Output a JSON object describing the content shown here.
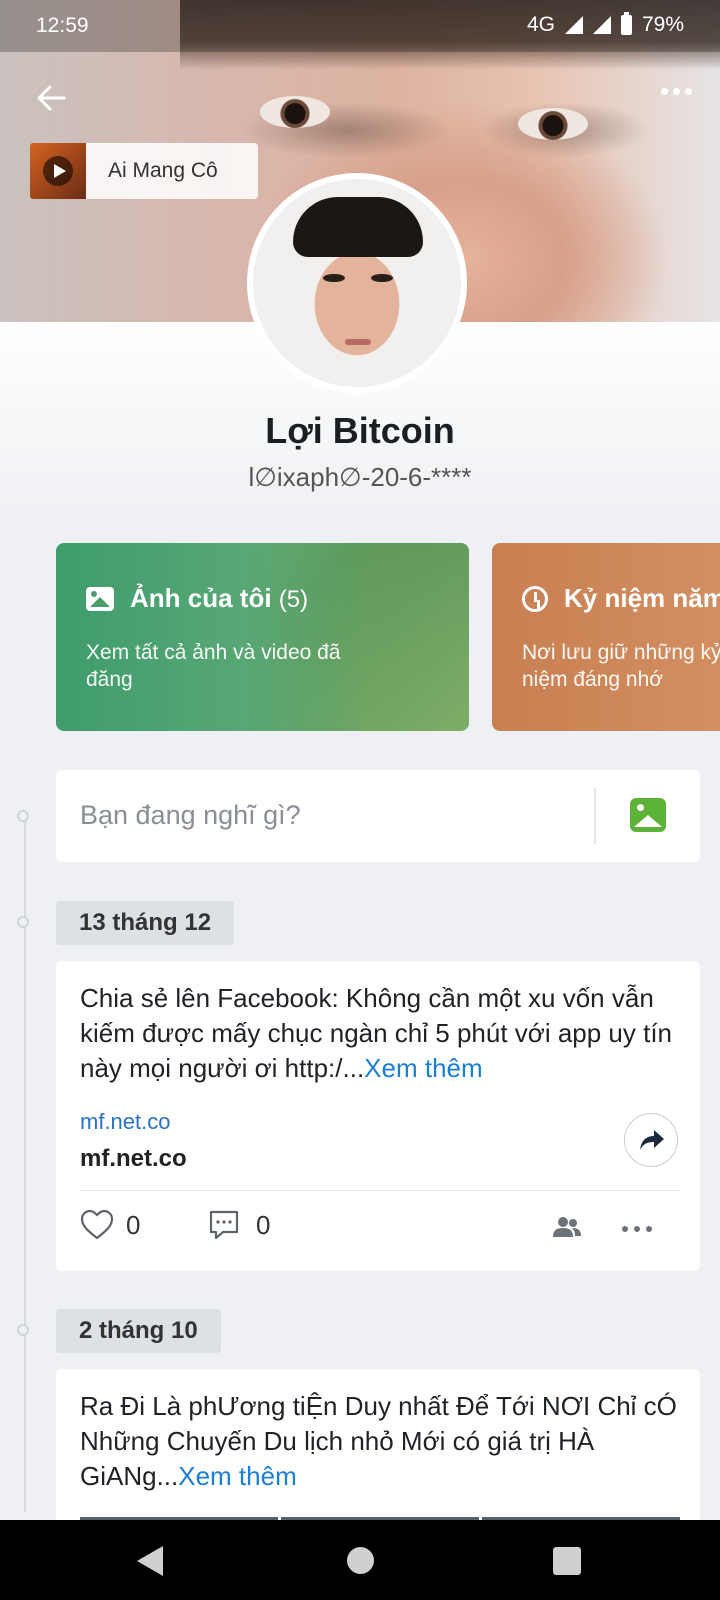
{
  "status_bar": {
    "time": "12:59",
    "network": "4G",
    "battery": "79%"
  },
  "music": {
    "title": "Ai Mang Cô"
  },
  "profile": {
    "name": "Lợi Bitcoin",
    "username": "l∅ixaph∅-20-6-****"
  },
  "cards": [
    {
      "title": "Ảnh của tôi",
      "count": "(5)",
      "desc": "Xem tất cả ảnh và video đã đăng",
      "icon": "image-icon"
    },
    {
      "title": "Kỷ niệm năm",
      "desc": "Nơi lưu giữ những kỷ niệm đáng nhớ",
      "icon": "clock-icon"
    }
  ],
  "composer": {
    "placeholder": "Bạn đang nghĩ gì?"
  },
  "posts": [
    {
      "date": "13 tháng 12",
      "text": "Chia sẻ lên Facebook: Không cần một xu vốn vẫn kiếm được mấy chục ngàn chỉ 5 phút với app uy tín này mọi người ơi http:/...",
      "more": "Xem thêm",
      "link_url": "mf.net.co",
      "link_title": "mf.net.co",
      "likes": "0",
      "comments": "0"
    },
    {
      "date": "2 tháng 10",
      "text": "Ra Đi Là phƯơng tiỆn Duy nhất Để Tới NƠI Chỉ cÓ Những Chuyến Du lịch nhỏ Mới có giá trị HÀ GiANg...",
      "more": "Xem thêm"
    }
  ],
  "colors": {
    "link": "#1a7fd8",
    "photos_card": "#3e9c6d",
    "memory_card": "#c97f51",
    "image_button": "#5cb338"
  }
}
